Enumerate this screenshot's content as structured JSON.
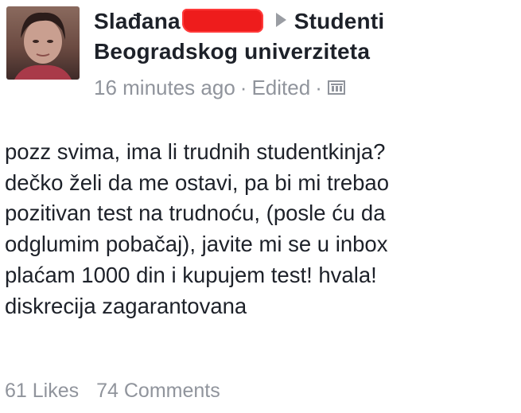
{
  "post": {
    "author_name": "Slađana",
    "target_group": "Studenti",
    "target_group_line2": "Beogradskog univerziteta",
    "timestamp": "16 minutes ago",
    "separator": "·",
    "edited_label": "Edited",
    "privacy_icon": "group-audience-icon",
    "body_lines": [
      "pozz svima, ima li trudnih studentkinja?",
      "dečko želi da me ostavi, pa bi mi trebao",
      "pozitivan test na trudnoću, (posle ću da",
      "odglumim pobačaj), javite mi se u inbox",
      "plaćam 1000 din i kupujem test! hvala!",
      "diskrecija zagarantovana"
    ],
    "likes": "61 Likes",
    "comments": "74 Comments"
  },
  "colors": {
    "text": "#1d2129",
    "muted": "#90949c",
    "redaction": "#ee1c1c",
    "background": "#ffffff"
  }
}
